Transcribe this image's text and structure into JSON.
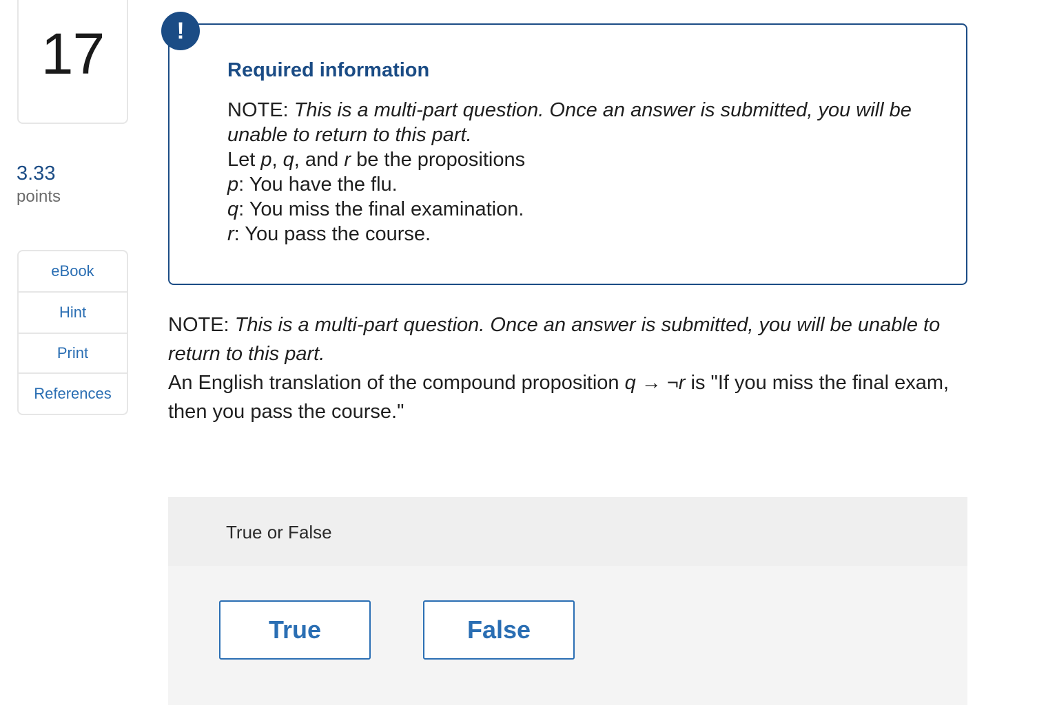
{
  "question": {
    "number": "17",
    "points_value": "3.33",
    "points_label": "points"
  },
  "tools": {
    "ebook": "eBook",
    "hint": "Hint",
    "print": "Print",
    "references": "References"
  },
  "required_info": {
    "badge": "!",
    "title": "Required information",
    "note_label": "NOTE:",
    "note_text": "This is a multi-part question. Once an answer is submitted, you will be unable to return to this part.",
    "let_prefix": "Let ",
    "p": "p",
    "comma1": ", ",
    "q": "q",
    "and": ", and ",
    "r": "r",
    "let_suffix": " be the propositions",
    "p_def": ": You have the flu.",
    "q_def": ": You miss the final examination.",
    "r_def": ": You pass the course."
  },
  "prompt": {
    "note_label": "NOTE:",
    "note_text": "This is a multi-part question. Once an answer is submitted, you will be unable to return to this part.",
    "lead": "An English translation of the compound proposition ",
    "q": "q",
    "arrow": " → ¬",
    "r": "r",
    "tail": " is \"If you miss the final exam, then you pass the course.\""
  },
  "answer": {
    "header": "True or False",
    "true_label": "True",
    "false_label": "False"
  },
  "colors": {
    "brand_navy": "#1b4c85",
    "link_blue": "#2a6eb3"
  }
}
